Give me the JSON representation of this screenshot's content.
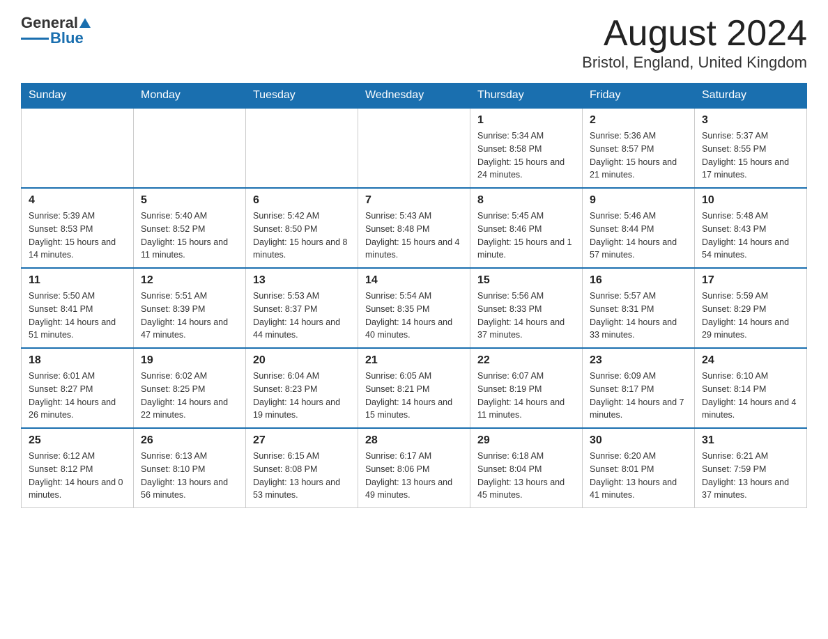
{
  "header": {
    "logo_general": "General",
    "logo_blue": "Blue",
    "month_title": "August 2024",
    "location": "Bristol, England, United Kingdom"
  },
  "days_of_week": [
    "Sunday",
    "Monday",
    "Tuesday",
    "Wednesday",
    "Thursday",
    "Friday",
    "Saturday"
  ],
  "weeks": [
    [
      {
        "day": "",
        "sunrise": "",
        "sunset": "",
        "daylight": ""
      },
      {
        "day": "",
        "sunrise": "",
        "sunset": "",
        "daylight": ""
      },
      {
        "day": "",
        "sunrise": "",
        "sunset": "",
        "daylight": ""
      },
      {
        "day": "",
        "sunrise": "",
        "sunset": "",
        "daylight": ""
      },
      {
        "day": "1",
        "sunrise": "Sunrise: 5:34 AM",
        "sunset": "Sunset: 8:58 PM",
        "daylight": "Daylight: 15 hours and 24 minutes."
      },
      {
        "day": "2",
        "sunrise": "Sunrise: 5:36 AM",
        "sunset": "Sunset: 8:57 PM",
        "daylight": "Daylight: 15 hours and 21 minutes."
      },
      {
        "day": "3",
        "sunrise": "Sunrise: 5:37 AM",
        "sunset": "Sunset: 8:55 PM",
        "daylight": "Daylight: 15 hours and 17 minutes."
      }
    ],
    [
      {
        "day": "4",
        "sunrise": "Sunrise: 5:39 AM",
        "sunset": "Sunset: 8:53 PM",
        "daylight": "Daylight: 15 hours and 14 minutes."
      },
      {
        "day": "5",
        "sunrise": "Sunrise: 5:40 AM",
        "sunset": "Sunset: 8:52 PM",
        "daylight": "Daylight: 15 hours and 11 minutes."
      },
      {
        "day": "6",
        "sunrise": "Sunrise: 5:42 AM",
        "sunset": "Sunset: 8:50 PM",
        "daylight": "Daylight: 15 hours and 8 minutes."
      },
      {
        "day": "7",
        "sunrise": "Sunrise: 5:43 AM",
        "sunset": "Sunset: 8:48 PM",
        "daylight": "Daylight: 15 hours and 4 minutes."
      },
      {
        "day": "8",
        "sunrise": "Sunrise: 5:45 AM",
        "sunset": "Sunset: 8:46 PM",
        "daylight": "Daylight: 15 hours and 1 minute."
      },
      {
        "day": "9",
        "sunrise": "Sunrise: 5:46 AM",
        "sunset": "Sunset: 8:44 PM",
        "daylight": "Daylight: 14 hours and 57 minutes."
      },
      {
        "day": "10",
        "sunrise": "Sunrise: 5:48 AM",
        "sunset": "Sunset: 8:43 PM",
        "daylight": "Daylight: 14 hours and 54 minutes."
      }
    ],
    [
      {
        "day": "11",
        "sunrise": "Sunrise: 5:50 AM",
        "sunset": "Sunset: 8:41 PM",
        "daylight": "Daylight: 14 hours and 51 minutes."
      },
      {
        "day": "12",
        "sunrise": "Sunrise: 5:51 AM",
        "sunset": "Sunset: 8:39 PM",
        "daylight": "Daylight: 14 hours and 47 minutes."
      },
      {
        "day": "13",
        "sunrise": "Sunrise: 5:53 AM",
        "sunset": "Sunset: 8:37 PM",
        "daylight": "Daylight: 14 hours and 44 minutes."
      },
      {
        "day": "14",
        "sunrise": "Sunrise: 5:54 AM",
        "sunset": "Sunset: 8:35 PM",
        "daylight": "Daylight: 14 hours and 40 minutes."
      },
      {
        "day": "15",
        "sunrise": "Sunrise: 5:56 AM",
        "sunset": "Sunset: 8:33 PM",
        "daylight": "Daylight: 14 hours and 37 minutes."
      },
      {
        "day": "16",
        "sunrise": "Sunrise: 5:57 AM",
        "sunset": "Sunset: 8:31 PM",
        "daylight": "Daylight: 14 hours and 33 minutes."
      },
      {
        "day": "17",
        "sunrise": "Sunrise: 5:59 AM",
        "sunset": "Sunset: 8:29 PM",
        "daylight": "Daylight: 14 hours and 29 minutes."
      }
    ],
    [
      {
        "day": "18",
        "sunrise": "Sunrise: 6:01 AM",
        "sunset": "Sunset: 8:27 PM",
        "daylight": "Daylight: 14 hours and 26 minutes."
      },
      {
        "day": "19",
        "sunrise": "Sunrise: 6:02 AM",
        "sunset": "Sunset: 8:25 PM",
        "daylight": "Daylight: 14 hours and 22 minutes."
      },
      {
        "day": "20",
        "sunrise": "Sunrise: 6:04 AM",
        "sunset": "Sunset: 8:23 PM",
        "daylight": "Daylight: 14 hours and 19 minutes."
      },
      {
        "day": "21",
        "sunrise": "Sunrise: 6:05 AM",
        "sunset": "Sunset: 8:21 PM",
        "daylight": "Daylight: 14 hours and 15 minutes."
      },
      {
        "day": "22",
        "sunrise": "Sunrise: 6:07 AM",
        "sunset": "Sunset: 8:19 PM",
        "daylight": "Daylight: 14 hours and 11 minutes."
      },
      {
        "day": "23",
        "sunrise": "Sunrise: 6:09 AM",
        "sunset": "Sunset: 8:17 PM",
        "daylight": "Daylight: 14 hours and 7 minutes."
      },
      {
        "day": "24",
        "sunrise": "Sunrise: 6:10 AM",
        "sunset": "Sunset: 8:14 PM",
        "daylight": "Daylight: 14 hours and 4 minutes."
      }
    ],
    [
      {
        "day": "25",
        "sunrise": "Sunrise: 6:12 AM",
        "sunset": "Sunset: 8:12 PM",
        "daylight": "Daylight: 14 hours and 0 minutes."
      },
      {
        "day": "26",
        "sunrise": "Sunrise: 6:13 AM",
        "sunset": "Sunset: 8:10 PM",
        "daylight": "Daylight: 13 hours and 56 minutes."
      },
      {
        "day": "27",
        "sunrise": "Sunrise: 6:15 AM",
        "sunset": "Sunset: 8:08 PM",
        "daylight": "Daylight: 13 hours and 53 minutes."
      },
      {
        "day": "28",
        "sunrise": "Sunrise: 6:17 AM",
        "sunset": "Sunset: 8:06 PM",
        "daylight": "Daylight: 13 hours and 49 minutes."
      },
      {
        "day": "29",
        "sunrise": "Sunrise: 6:18 AM",
        "sunset": "Sunset: 8:04 PM",
        "daylight": "Daylight: 13 hours and 45 minutes."
      },
      {
        "day": "30",
        "sunrise": "Sunrise: 6:20 AM",
        "sunset": "Sunset: 8:01 PM",
        "daylight": "Daylight: 13 hours and 41 minutes."
      },
      {
        "day": "31",
        "sunrise": "Sunrise: 6:21 AM",
        "sunset": "Sunset: 7:59 PM",
        "daylight": "Daylight: 13 hours and 37 minutes."
      }
    ]
  ]
}
